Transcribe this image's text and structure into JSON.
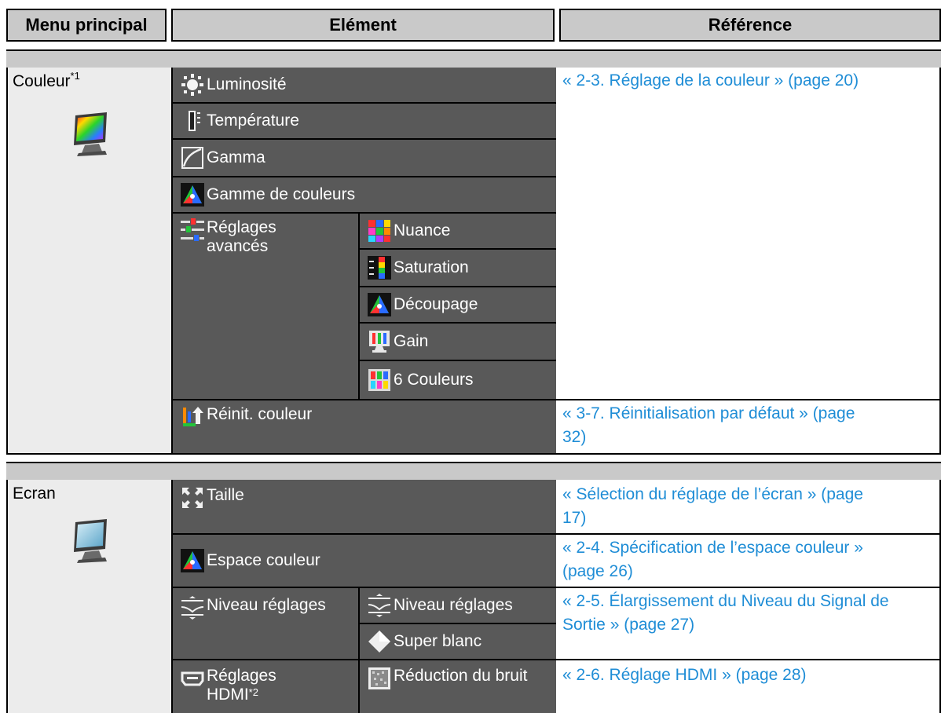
{
  "header": {
    "col1": "Menu principal",
    "col2": "Elément",
    "col3": "Référence"
  },
  "couleur": {
    "label": "Couleur",
    "label_note": "*1",
    "menu_icon": "color-monitor-icon",
    "items": {
      "luminosite": {
        "label": "Luminosité",
        "icon": "brightness-icon"
      },
      "temperature": {
        "label": "Température",
        "icon": "thermometer-icon"
      },
      "gamma": {
        "label": "Gamma",
        "icon": "gamma-curve-icon"
      },
      "gamme": {
        "label": "Gamme de couleurs",
        "icon": "color-triangle-icon"
      },
      "avances": {
        "label": "Réglages avancés",
        "icon": "advanced-settings-icon"
      },
      "nuance": {
        "label": "Nuance",
        "icon": "hue-icon"
      },
      "saturation": {
        "label": "Saturation",
        "icon": "saturation-icon"
      },
      "decoupage": {
        "label": "Découpage",
        "icon": "clipping-icon"
      },
      "gain": {
        "label": "Gain",
        "icon": "gain-icon"
      },
      "six_couleurs": {
        "label": "6 Couleurs",
        "icon": "six-colors-icon"
      },
      "reinit": {
        "label": "Réinit. couleur",
        "icon": "reset-icon"
      }
    },
    "refs": {
      "reglage_couleur": "« 2-3. Réglage de la couleur » (page 20)",
      "reinit_line1": "« 3-7. Réinitialisation par défaut » (page",
      "reinit_line2": "32)"
    }
  },
  "ecran": {
    "label": "Ecran",
    "menu_icon": "screen-monitor-icon",
    "items": {
      "taille": {
        "label": "Taille",
        "icon": "expand-icon"
      },
      "espace": {
        "label": "Espace couleur",
        "icon": "color-space-icon"
      },
      "niveau": {
        "label": "Niveau réglages",
        "icon": "level-icon"
      },
      "niveau_sub": {
        "label": "Niveau réglages",
        "icon": "level-icon"
      },
      "super_blanc": {
        "label": "Super blanc",
        "icon": "diamond-icon"
      },
      "hdmi": {
        "label": "Réglages HDMI",
        "note": "*2",
        "icon": "hdmi-icon"
      },
      "bruit": {
        "label": "Réduction du bruit",
        "icon": "noise-icon"
      }
    },
    "refs": {
      "taille_line1": "« Sélection du réglage de l’écran » (page",
      "taille_line2": "17)",
      "espace_line1": "« 2-4. Spécification de l’espace couleur »",
      "espace_line2": "(page 26)",
      "niveau_line1": "« 2-5. Élargissement du Niveau du Signal de",
      "niveau_line2": "Sortie » (page 27)",
      "hdmi": "« 2-6. Réglage HDMI » (page 28)"
    }
  },
  "colors": {
    "header_bg": "#c9c9c9",
    "cell_bg": "#595959",
    "link": "#1f8dd6",
    "label_bg": "#ececec"
  }
}
